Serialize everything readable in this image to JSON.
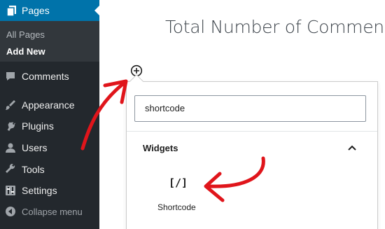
{
  "sidebar": {
    "pages": {
      "label": "Pages",
      "icon": "pages-icon"
    },
    "submenu": [
      "All Pages",
      "Add New"
    ],
    "items": [
      {
        "label": "Comments",
        "icon": "comments-icon"
      },
      {
        "label": "Appearance",
        "icon": "appearance-icon"
      },
      {
        "label": "Plugins",
        "icon": "plugins-icon"
      },
      {
        "label": "Users",
        "icon": "users-icon"
      },
      {
        "label": "Tools",
        "icon": "tools-icon"
      },
      {
        "label": "Settings",
        "icon": "settings-icon"
      }
    ],
    "collapse_label": "Collapse menu"
  },
  "editor": {
    "title": "Total Number of Comments"
  },
  "inserter": {
    "search_value": "shortcode",
    "panel_title": "Widgets",
    "block_icon_text": "[/]",
    "block_label": "Shortcode"
  },
  "colors": {
    "sidebar_bg": "#23282d",
    "submenu_bg": "#32373c",
    "active_blue": "#0073aa",
    "annotation_red": "#e0151b"
  }
}
